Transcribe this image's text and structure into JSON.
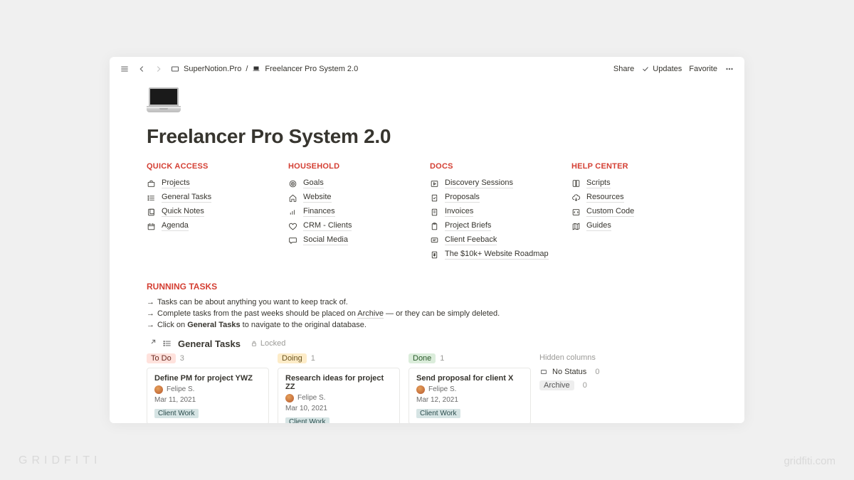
{
  "topbar": {
    "breadcrumb_parent": "SuperNotion.Pro",
    "breadcrumb_current": "Freelancer Pro System 2.0",
    "share": "Share",
    "updates": "Updates",
    "favorite": "Favorite"
  },
  "page": {
    "title": "Freelancer Pro System 2.0"
  },
  "sections": {
    "quick_access": {
      "heading": "QUICK ACCESS",
      "items": [
        "Projects",
        "General Tasks",
        "Quick Notes",
        "Agenda"
      ]
    },
    "household": {
      "heading": "HOUSEHOLD",
      "items": [
        "Goals",
        "Website",
        "Finances",
        "CRM - Clients",
        "Social Media"
      ]
    },
    "docs": {
      "heading": "DOCS",
      "items": [
        "Discovery Sessions",
        "Proposals",
        "Invoices",
        "Project Briefs",
        "Client Feeback",
        "The $10k+ Website Roadmap"
      ]
    },
    "help_center": {
      "heading": "HELP CENTER",
      "items": [
        "Scripts",
        "Resources",
        "Custom Code",
        "Guides"
      ]
    }
  },
  "running": {
    "heading": "RUNNING TASKS",
    "hint1_a": "Tasks can be about anything you want to keep track of.",
    "hint2_a": "Complete tasks from the past weeks should be placed on ",
    "hint2_link": "Archive",
    "hint2_b": " — or they can be simply deleted.",
    "hint3_a": "Click on ",
    "hint3_bold": "General Tasks",
    "hint3_b": " to navigate to the original database.",
    "db_title": "General Tasks",
    "locked": "Locked"
  },
  "board": {
    "todo": {
      "label": "To Do",
      "count": "3"
    },
    "doing": {
      "label": "Doing",
      "count": "1"
    },
    "done": {
      "label": "Done",
      "count": "1"
    },
    "hidden_label": "Hidden columns",
    "nostatus": {
      "label": "No Status",
      "count": "0"
    },
    "archive": {
      "label": "Archive",
      "count": "0"
    },
    "cards": {
      "c1": {
        "title": "Define PM for project YWZ",
        "author": "Felipe S.",
        "date": "Mar 11, 2021",
        "chip": "Client Work"
      },
      "c2": {
        "title": "Research ideas for project ZZ",
        "author": "Felipe S.",
        "date": "Mar 10, 2021",
        "chip": "Client Work"
      },
      "c3": {
        "title": "Send proposal for client X",
        "author": "Felipe S.",
        "date": "Mar 12, 2021",
        "chip": "Client Work"
      }
    }
  },
  "watermark": {
    "left": "GRIDFITI",
    "right": "gridfiti.com"
  }
}
